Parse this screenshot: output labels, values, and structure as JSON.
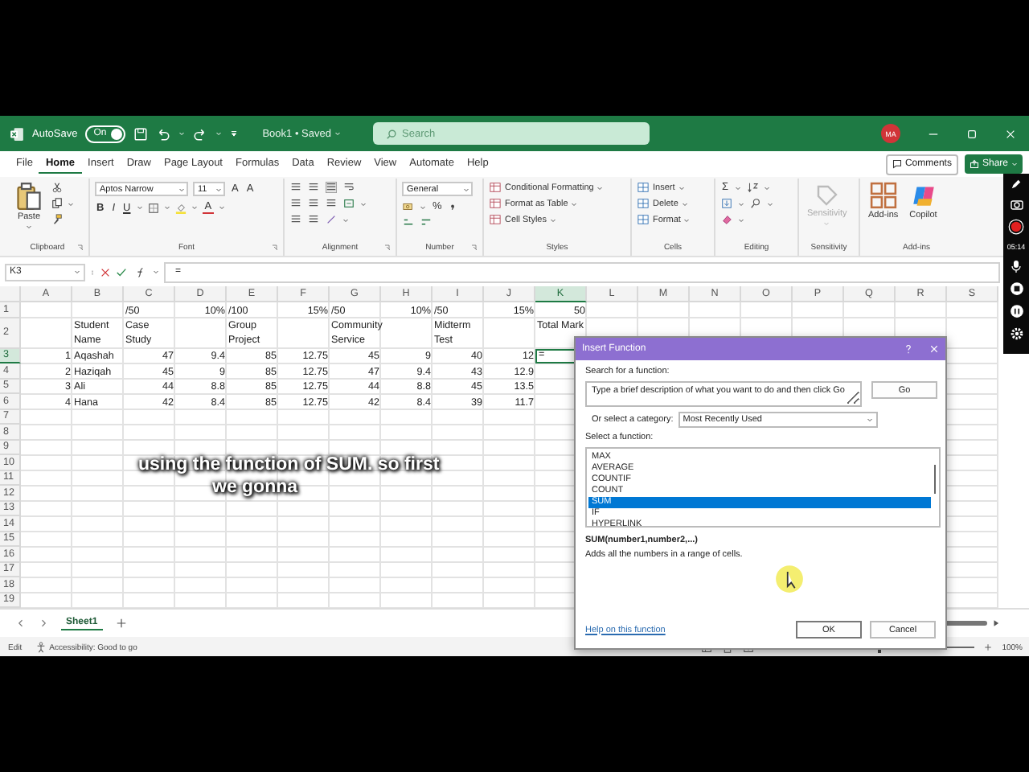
{
  "title_bar": {
    "autosave_label": "AutoSave",
    "autosave_toggle": {
      "label": "On",
      "on": true
    },
    "document_title": "Book1 • Saved",
    "search": {
      "placeholder": "Search"
    },
    "avatar": "MA"
  },
  "menu_tabs": [
    {
      "label": "File",
      "selected": false
    },
    {
      "label": "Home",
      "selected": true
    },
    {
      "label": "Insert",
      "selected": false
    },
    {
      "label": "Draw",
      "selected": false
    },
    {
      "label": "Page Layout",
      "selected": false
    },
    {
      "label": "Formulas",
      "selected": false
    },
    {
      "label": "Data",
      "selected": false
    },
    {
      "label": "Review",
      "selected": false
    },
    {
      "label": "View",
      "selected": false
    },
    {
      "label": "Automate",
      "selected": false
    },
    {
      "label": "Help",
      "selected": false
    }
  ],
  "comments_button": "Comments",
  "share_button": "Share",
  "ribbon_groups": [
    {
      "kind": "clipboard",
      "label": "Clipboard",
      "paste": "Paste"
    },
    {
      "kind": "font",
      "label": "Font",
      "font_name": "Aptos Narrow",
      "font_size": "11",
      "size_buttons": [
        "A",
        "A"
      ],
      "style_buttons": [
        "B",
        "I",
        "U"
      ],
      "color_button": "A"
    },
    {
      "kind": "alignment",
      "label": "Alignment"
    },
    {
      "kind": "number",
      "label": "Number",
      "format": "General",
      "percent": "%"
    },
    {
      "kind": "styles",
      "label": "Styles",
      "items": [
        "Conditional Formatting",
        "Format as Table",
        "Cell Styles"
      ]
    },
    {
      "kind": "cells",
      "label": "Cells",
      "items": [
        "Insert",
        "Delete",
        "Format"
      ]
    },
    {
      "kind": "editing",
      "label": "Editing",
      "sum_symbol": "Σ"
    },
    {
      "kind": "sensitivity",
      "label": "Sensitivity",
      "button": "Sensitivity",
      "disabled": true
    },
    {
      "kind": "addins",
      "label": "Add-ins",
      "buttons": [
        "Add-ins",
        "Copilot"
      ]
    }
  ],
  "formula_bar": {
    "name_box": "K3",
    "formula": "="
  },
  "sheet": {
    "columns": [
      "A",
      "B",
      "C",
      "D",
      "E",
      "F",
      "G",
      "H",
      "I",
      "J",
      "K",
      "L",
      "M",
      "N",
      "O",
      "P",
      "Q",
      "R",
      "S"
    ],
    "row_numbers": [
      "1",
      "2",
      "3",
      "4",
      "5",
      "6",
      "7",
      "8",
      "9",
      "10",
      "11",
      "12",
      "13",
      "14",
      "15",
      "16",
      "17",
      "18",
      "19"
    ],
    "rows": [
      [
        null,
        null,
        {
          "text": "/50",
          "kind": "text",
          "selected": false
        },
        {
          "text": "10%",
          "kind": "number",
          "selected": false
        },
        {
          "text": "/100",
          "kind": "text",
          "selected": false
        },
        {
          "text": "15%",
          "kind": "number",
          "selected": false
        },
        {
          "text": "/50",
          "kind": "text",
          "selected": false
        },
        {
          "text": "10%",
          "kind": "number",
          "selected": false
        },
        {
          "text": "/50",
          "kind": "text",
          "selected": false
        },
        {
          "text": "15%",
          "kind": "number",
          "selected": false
        },
        {
          "text": "50",
          "kind": "number",
          "selected": false
        }
      ],
      [
        null,
        {
          "text": "Student Name",
          "kind": "text",
          "selected": false
        },
        {
          "text": "Case Study",
          "kind": "text",
          "selected": false
        },
        null,
        {
          "text": "Group Project",
          "kind": "text",
          "selected": false
        },
        null,
        {
          "text": "Community Service",
          "kind": "text",
          "selected": false
        },
        null,
        {
          "text": "Midterm Test",
          "kind": "text",
          "selected": false
        },
        null,
        {
          "text": "Total Mark",
          "kind": "text",
          "selected": false
        }
      ],
      [
        {
          "text": "1",
          "kind": "number",
          "selected": false
        },
        {
          "text": "Aqashah",
          "kind": "text",
          "selected": false
        },
        {
          "text": "47",
          "kind": "number",
          "selected": false
        },
        {
          "text": "9.4",
          "kind": "number",
          "selected": false
        },
        {
          "text": "85",
          "kind": "number",
          "selected": false
        },
        {
          "text": "12.75",
          "kind": "number",
          "selected": false
        },
        {
          "text": "45",
          "kind": "number",
          "selected": false
        },
        {
          "text": "9",
          "kind": "number",
          "selected": false
        },
        {
          "text": "40",
          "kind": "number",
          "selected": false
        },
        {
          "text": "12",
          "kind": "number",
          "selected": false
        },
        {
          "text": "=",
          "kind": "text",
          "selected": true
        }
      ],
      [
        {
          "text": "2",
          "kind": "number",
          "selected": false
        },
        {
          "text": "Haziqah",
          "kind": "text",
          "selected": false
        },
        {
          "text": "45",
          "kind": "number",
          "selected": false
        },
        {
          "text": "9",
          "kind": "number",
          "selected": false
        },
        {
          "text": "85",
          "kind": "number",
          "selected": false
        },
        {
          "text": "12.75",
          "kind": "number",
          "selected": false
        },
        {
          "text": "47",
          "kind": "number",
          "selected": false
        },
        {
          "text": "9.4",
          "kind": "number",
          "selected": false
        },
        {
          "text": "43",
          "kind": "number",
          "selected": false
        },
        {
          "text": "12.9",
          "kind": "number",
          "selected": false
        },
        null
      ],
      [
        {
          "text": "3",
          "kind": "number",
          "selected": false
        },
        {
          "text": "Ali",
          "kind": "text",
          "selected": false
        },
        {
          "text": "44",
          "kind": "number",
          "selected": false
        },
        {
          "text": "8.8",
          "kind": "number",
          "selected": false
        },
        {
          "text": "85",
          "kind": "number",
          "selected": false
        },
        {
          "text": "12.75",
          "kind": "number",
          "selected": false
        },
        {
          "text": "44",
          "kind": "number",
          "selected": false
        },
        {
          "text": "8.8",
          "kind": "number",
          "selected": false
        },
        {
          "text": "45",
          "kind": "number",
          "selected": false
        },
        {
          "text": "13.5",
          "kind": "number",
          "selected": false
        },
        null
      ],
      [
        {
          "text": "4",
          "kind": "number",
          "selected": false
        },
        {
          "text": "Hana",
          "kind": "text",
          "selected": false
        },
        {
          "text": "42",
          "kind": "number",
          "selected": false
        },
        {
          "text": "8.4",
          "kind": "number",
          "selected": false
        },
        {
          "text": "85",
          "kind": "number",
          "selected": false
        },
        {
          "text": "12.75",
          "kind": "number",
          "selected": false
        },
        {
          "text": "42",
          "kind": "number",
          "selected": false
        },
        {
          "text": "8.4",
          "kind": "number",
          "selected": false
        },
        {
          "text": "39",
          "kind": "number",
          "selected": false
        },
        {
          "text": "11.7",
          "kind": "number",
          "selected": false
        },
        null
      ]
    ]
  },
  "caption": [
    "using the function of SUM. so first",
    "we gonna"
  ],
  "sheet_tabs": [
    {
      "label": "Sheet1",
      "selected": true
    }
  ],
  "status_bar": {
    "mode": "Edit",
    "accessibility": "Accessibility: Good to go",
    "zoom_slider": {
      "level": 0.5
    },
    "zoom": "100%"
  },
  "recorder": {
    "time": "05:14"
  },
  "dialog": {
    "title": "Insert Function",
    "search_label": "Search for a function:",
    "search_value": "Type a brief description of what you want to do and then click Go",
    "go_button": "Go",
    "category_label": "Or select a category:",
    "category_value": "Most Recently Used",
    "function_label": "Select a function:",
    "functions": [
      {
        "name": "MAX",
        "selected": false
      },
      {
        "name": "AVERAGE",
        "selected": false
      },
      {
        "name": "COUNTIF",
        "selected": false
      },
      {
        "name": "COUNT",
        "selected": false
      },
      {
        "name": "SUM",
        "selected": true
      },
      {
        "name": "IF",
        "selected": false
      },
      {
        "name": "HYPERLINK",
        "selected": false
      }
    ],
    "signature": "SUM(number1,number2,...)",
    "description": "Adds all the numbers in a range of cells.",
    "help_link": "Help on this function",
    "ok_button": "OK",
    "cancel_button": "Cancel"
  }
}
